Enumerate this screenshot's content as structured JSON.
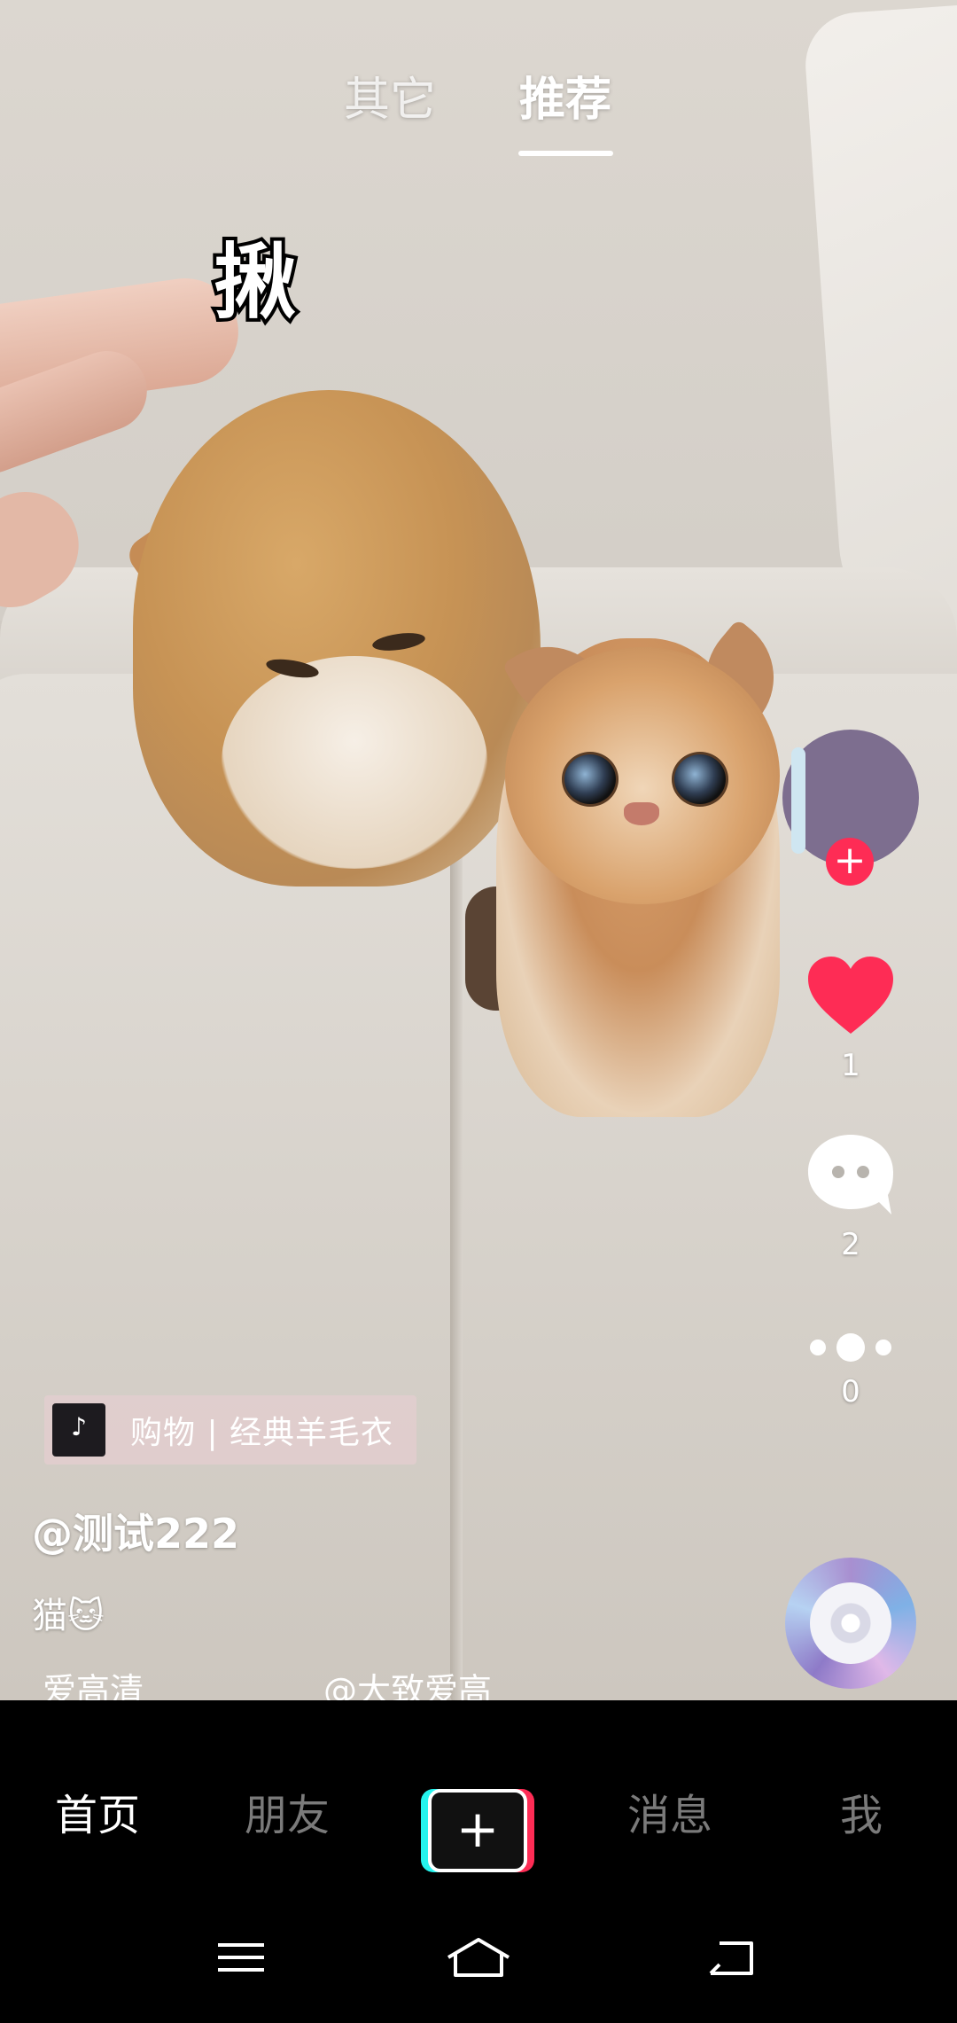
{
  "top_tabs": {
    "other": "其它",
    "recommended": "推荐"
  },
  "sticker_text": "揪",
  "actions": {
    "likes": "1",
    "comments": "2",
    "shares": "0"
  },
  "shop_tag": {
    "icon_text": "♪",
    "label": "购物 | 经典羊毛衣"
  },
  "author": "@测试222",
  "description": "猫🐱",
  "music_marquee": {
    "left": "爱高清",
    "right": "@大致爱高"
  },
  "bottom_nav": {
    "home": "首页",
    "friends": "朋友",
    "create": "+",
    "messages": "消息",
    "me": "我"
  },
  "colors": {
    "accent": "#fe2c55",
    "tiktok_cyan": "#25f4ee",
    "avatar_bg": "#7d6e8f"
  },
  "icons": [
    "heart-icon",
    "comment-icon",
    "more-icon",
    "music-disc-icon",
    "menu-icon",
    "home-icon",
    "back-icon"
  ]
}
